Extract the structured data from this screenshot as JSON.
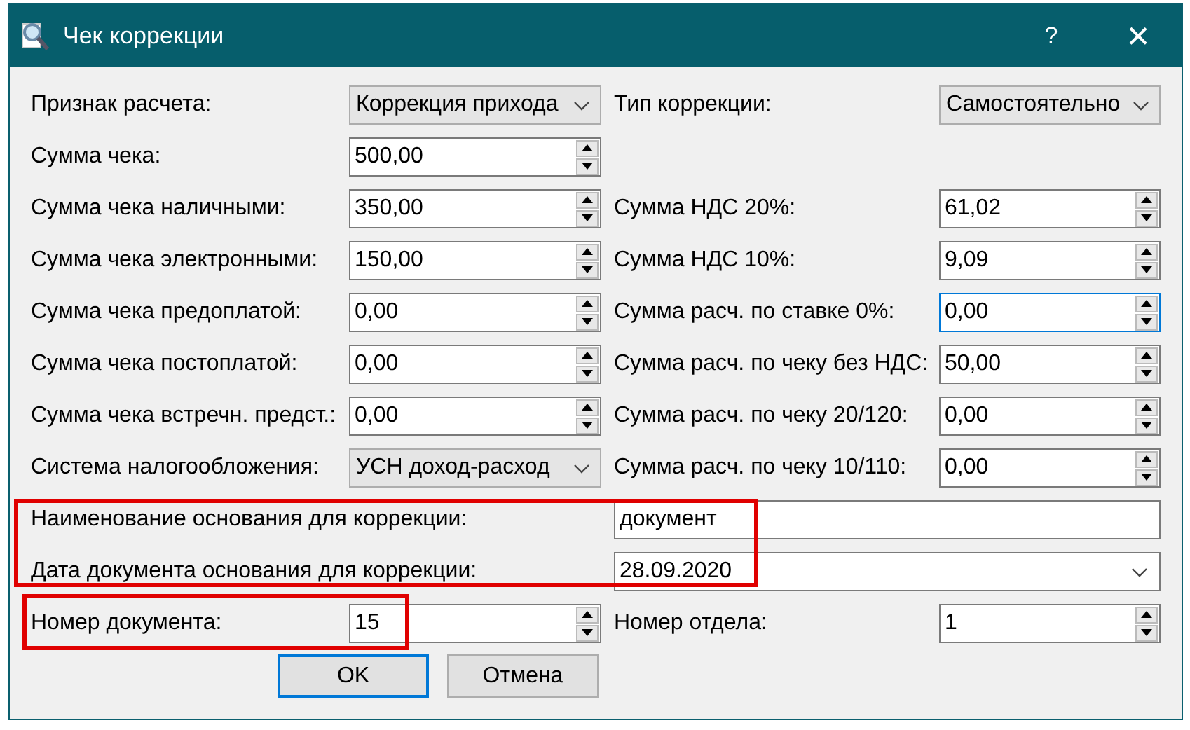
{
  "window": {
    "title": "Чек коррекции",
    "help": "?",
    "close": "×"
  },
  "rows": [
    {
      "left": {
        "label": "Признак расчета:",
        "kind": "combo",
        "value": "Коррекция прихода"
      },
      "right": {
        "label": "Тип коррекции:",
        "kind": "combo",
        "value": "Самостоятельно"
      }
    },
    {
      "left": {
        "label": "Сумма чека:",
        "kind": "spin",
        "value": "500,00"
      }
    },
    {
      "left": {
        "label": "Сумма чека наличными:",
        "kind": "spin",
        "value": "350,00"
      },
      "right": {
        "label": "Сумма НДС 20%:",
        "kind": "spin",
        "value": "61,02"
      }
    },
    {
      "left": {
        "label": "Сумма чека электронными:",
        "kind": "spin",
        "value": "150,00"
      },
      "right": {
        "label": "Сумма НДС 10%:",
        "kind": "spin",
        "value": "9,09"
      }
    },
    {
      "left": {
        "label": "Сумма чека предоплатой:",
        "kind": "spin",
        "value": "0,00"
      },
      "right": {
        "label": "Сумма расч. по ставке 0%:",
        "kind": "spin",
        "value": "0,00",
        "focused": true
      }
    },
    {
      "left": {
        "label": "Сумма чека постоплатой:",
        "kind": "spin",
        "value": "0,00"
      },
      "right": {
        "label": "Сумма расч. по чеку без НДС:",
        "kind": "spin",
        "value": "50,00"
      }
    },
    {
      "left": {
        "label": "Сумма чека встречн. предст.:",
        "kind": "spin",
        "value": "0,00"
      },
      "right": {
        "label": "Сумма расч. по чеку 20/120:",
        "kind": "spin",
        "value": "0,00"
      }
    },
    {
      "left": {
        "label": "Система налогообложения:",
        "kind": "combo",
        "value": "УСН доход-расход"
      },
      "right": {
        "label": "Сумма расч. по чеку 10/110:",
        "kind": "spin",
        "value": "0,00"
      }
    },
    {
      "wide": {
        "label": "Наименование основания для коррекции:",
        "kind": "text",
        "value": "документ"
      }
    },
    {
      "wide": {
        "label": "Дата документа основания для коррекции:",
        "kind": "date",
        "value": "28.09.2020"
      }
    },
    {
      "left": {
        "label": "Номер документа:",
        "kind": "spin",
        "value": "15"
      },
      "right": {
        "label": "Номер отдела:",
        "kind": "spin",
        "value": "1"
      }
    }
  ],
  "buttons": [
    {
      "label": "OK",
      "default": true
    },
    {
      "label": "Отмена",
      "default": false
    }
  ]
}
